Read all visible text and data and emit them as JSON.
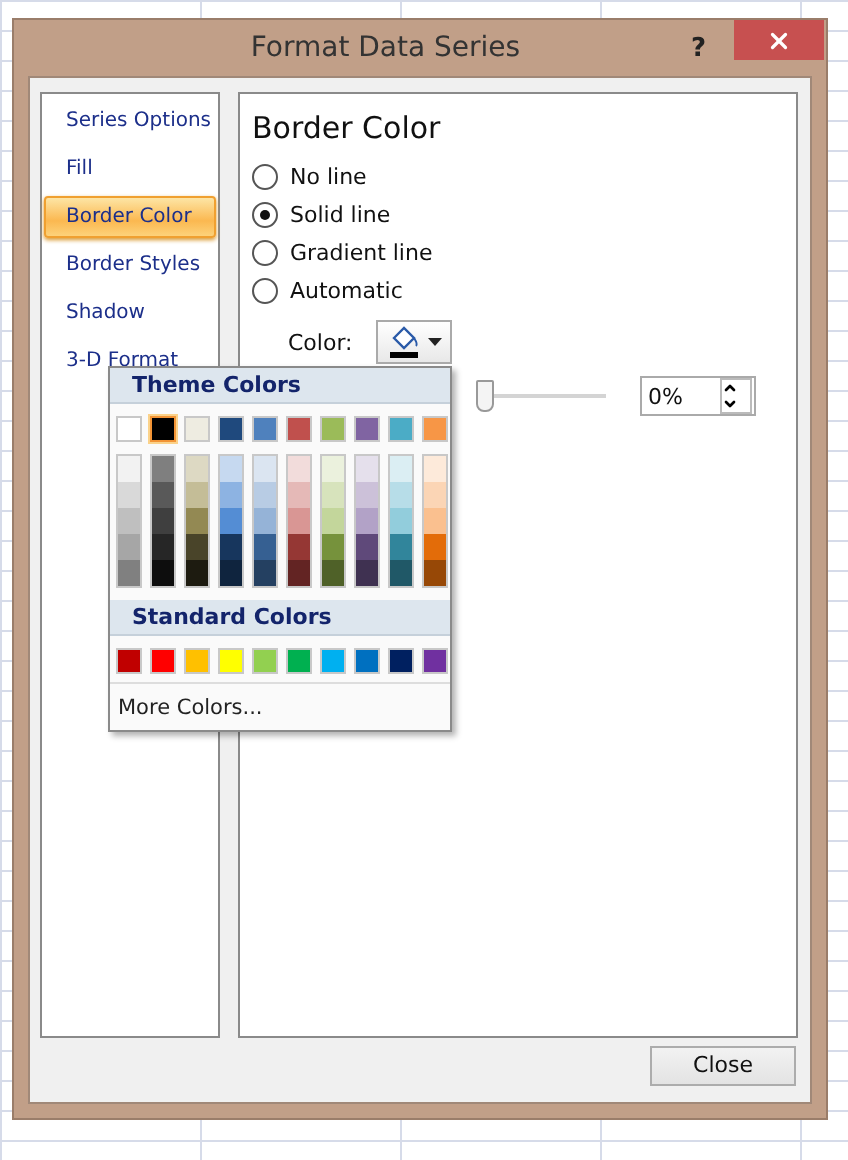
{
  "window": {
    "title": "Format Data Series",
    "help": "?"
  },
  "sidebar": {
    "items": [
      {
        "label": "Series Options",
        "selected": false
      },
      {
        "label": "Fill",
        "selected": false
      },
      {
        "label": "Border Color",
        "selected": true
      },
      {
        "label": "Border Styles",
        "selected": false
      },
      {
        "label": "Shadow",
        "selected": false
      },
      {
        "label": "3-D Format",
        "selected": false
      }
    ]
  },
  "panel": {
    "heading": "Border Color",
    "options": [
      {
        "label": "No line",
        "selected": false
      },
      {
        "label": "Solid line",
        "selected": true
      },
      {
        "label": "Gradient line",
        "selected": false
      },
      {
        "label": "Automatic",
        "selected": false
      }
    ],
    "color_label": "Color:",
    "transparency": {
      "level": 0,
      "value": "0%"
    }
  },
  "color_picker": {
    "theme_header": "Theme Colors",
    "theme_colors": [
      {
        "color": "#ffffff",
        "selected": false
      },
      {
        "color": "#000000",
        "selected": true
      },
      {
        "color": "#eeece1",
        "selected": false
      },
      {
        "color": "#1f497d",
        "selected": false
      },
      {
        "color": "#4f81bd",
        "selected": false
      },
      {
        "color": "#c0504d",
        "selected": false
      },
      {
        "color": "#9bbb59",
        "selected": false
      },
      {
        "color": "#8064a2",
        "selected": false
      },
      {
        "color": "#4bacc6",
        "selected": false
      },
      {
        "color": "#f79646",
        "selected": false
      }
    ],
    "theme_shades": [
      {
        "shades": [
          {
            "color": "#f2f2f2",
            "selected": false
          },
          {
            "color": "#d9d9d9",
            "selected": false
          },
          {
            "color": "#bfbfbf",
            "selected": false
          },
          {
            "color": "#a6a6a6",
            "selected": false
          },
          {
            "color": "#808080",
            "selected": false
          }
        ]
      },
      {
        "shades": [
          {
            "color": "#7f7f7f",
            "selected": false
          },
          {
            "color": "#595959",
            "selected": false
          },
          {
            "color": "#3f3f3f",
            "selected": false
          },
          {
            "color": "#262626",
            "selected": false
          },
          {
            "color": "#0d0d0d",
            "selected": false
          }
        ]
      },
      {
        "shades": [
          {
            "color": "#ddd9c3",
            "selected": false
          },
          {
            "color": "#c4bd97",
            "selected": false
          },
          {
            "color": "#938953",
            "selected": false
          },
          {
            "color": "#494429",
            "selected": false
          },
          {
            "color": "#1d1b10",
            "selected": false
          }
        ]
      },
      {
        "shades": [
          {
            "color": "#c6d9f0",
            "selected": false
          },
          {
            "color": "#8db3e2",
            "selected": false
          },
          {
            "color": "#548dd4",
            "selected": false
          },
          {
            "color": "#17365d",
            "selected": false
          },
          {
            "color": "#0f243e",
            "selected": false
          }
        ]
      },
      {
        "shades": [
          {
            "color": "#dbe5f1",
            "selected": false
          },
          {
            "color": "#b8cce4",
            "selected": false
          },
          {
            "color": "#95b3d7",
            "selected": false
          },
          {
            "color": "#366092",
            "selected": false
          },
          {
            "color": "#244061",
            "selected": false
          }
        ]
      },
      {
        "shades": [
          {
            "color": "#f2dcdb",
            "selected": false
          },
          {
            "color": "#e5b9b7",
            "selected": false
          },
          {
            "color": "#d99694",
            "selected": false
          },
          {
            "color": "#953734",
            "selected": false
          },
          {
            "color": "#632423",
            "selected": false
          }
        ]
      },
      {
        "shades": [
          {
            "color": "#ebf1dd",
            "selected": false
          },
          {
            "color": "#d7e3bc",
            "selected": false
          },
          {
            "color": "#c3d69b",
            "selected": false
          },
          {
            "color": "#76923c",
            "selected": false
          },
          {
            "color": "#4f6128",
            "selected": false
          }
        ]
      },
      {
        "shades": [
          {
            "color": "#e5e0ec",
            "selected": false
          },
          {
            "color": "#ccc1d9",
            "selected": false
          },
          {
            "color": "#b2a2c7",
            "selected": false
          },
          {
            "color": "#5f497a",
            "selected": false
          },
          {
            "color": "#3f3151",
            "selected": false
          }
        ]
      },
      {
        "shades": [
          {
            "color": "#dbeef3",
            "selected": false
          },
          {
            "color": "#b7dde8",
            "selected": false
          },
          {
            "color": "#92cddc",
            "selected": false
          },
          {
            "color": "#31859b",
            "selected": false
          },
          {
            "color": "#205867",
            "selected": false
          }
        ]
      },
      {
        "shades": [
          {
            "color": "#fdeada",
            "selected": false
          },
          {
            "color": "#fbd5b5",
            "selected": false
          },
          {
            "color": "#fac08f",
            "selected": false
          },
          {
            "color": "#e36c09",
            "selected": false
          },
          {
            "color": "#974806",
            "selected": false
          }
        ]
      }
    ],
    "standard_header": "Standard Colors",
    "standard_colors": [
      {
        "color": "#c00000",
        "selected": false
      },
      {
        "color": "#ff0000",
        "selected": false
      },
      {
        "color": "#ffc000",
        "selected": false
      },
      {
        "color": "#ffff00",
        "selected": false
      },
      {
        "color": "#92d050",
        "selected": false
      },
      {
        "color": "#00b050",
        "selected": false
      },
      {
        "color": "#00b0f0",
        "selected": false
      },
      {
        "color": "#0070c0",
        "selected": false
      },
      {
        "color": "#002060",
        "selected": false
      },
      {
        "color": "#7030a0",
        "selected": false
      }
    ],
    "more": "More Colors..."
  },
  "buttons": [
    {
      "label": "Close"
    }
  ]
}
